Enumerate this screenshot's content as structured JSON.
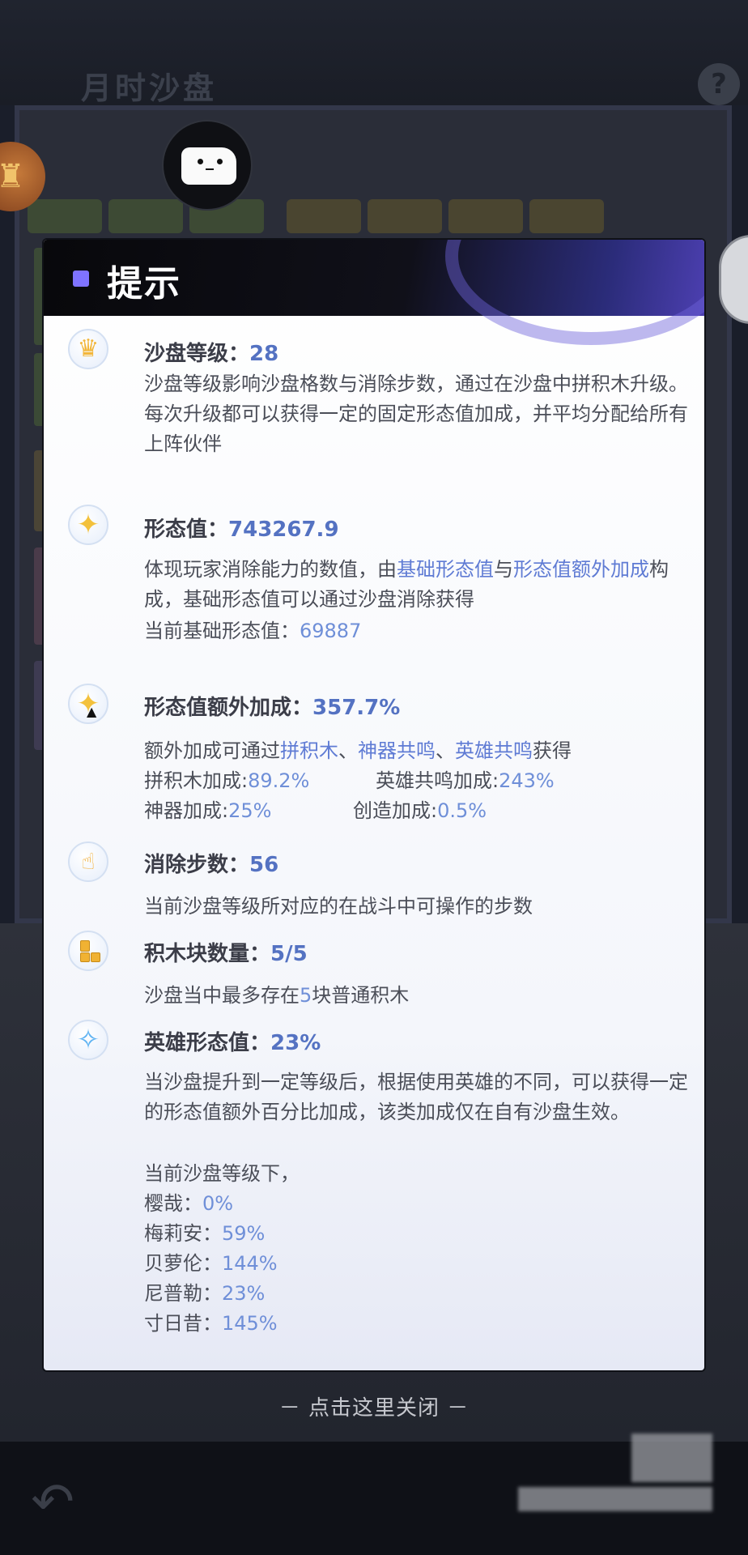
{
  "background": {
    "title": "月时沙盘",
    "help_glyph": "?"
  },
  "dialog": {
    "title": "提示",
    "sandbox_level": {
      "label": "沙盘等级：",
      "value": "28",
      "desc": "沙盘等级影响沙盘格数与消除步数，通过在沙盘中拼积木升级。每次升级都可以获得一定的固定形态值加成，并平均分配给所有上阵伙伴"
    },
    "form_value": {
      "label": "形态值：",
      "value": "743267.9",
      "desc_part1": "体现玩家消除能力的数值，由",
      "desc_link1": "基础形态值",
      "desc_part2": "与",
      "desc_link2": "形态值额外加成",
      "desc_part3": "构成，基础形态值可以通过沙盘消除获得",
      "base_label": "当前基础形态值：",
      "base_value": "69887"
    },
    "extra_bonus": {
      "label": "形态值额外加成：",
      "value": "357.7%",
      "desc_prefix": "额外加成可通过",
      "source1": "拼积木",
      "sep1": "、",
      "source2": "神器共鸣",
      "sep2": "、",
      "source3": "英雄共鸣",
      "desc_suffix": "获得",
      "block_label": "拼积木加成:",
      "block_value": "89.2%",
      "hero_label": "英雄共鸣加成:",
      "hero_value": "243%",
      "artifact_label": "神器加成:",
      "artifact_value": "25%",
      "create_label": "创造加成:",
      "create_value": "0.5%"
    },
    "steps": {
      "label": "消除步数：",
      "value": "56",
      "desc": "当前沙盘等级所对应的在战斗中可操作的步数"
    },
    "blocks": {
      "label": "积木块数量：",
      "value": "5/5",
      "desc_prefix": "沙盘当中最多存在",
      "desc_number": "5",
      "desc_suffix": "块普通积木"
    },
    "hero_form": {
      "label": "英雄形态值：",
      "value": "23%",
      "desc": "当沙盘提升到一定等级后，根据使用英雄的不同，可以获得一定的形态值额外百分比加成，该类加成仅在自有沙盘生效。",
      "current_label": "当前沙盘等级下，",
      "heroes": [
        {
          "name": "樱哉：",
          "value": "0%"
        },
        {
          "name": "梅莉安：",
          "value": "59%"
        },
        {
          "name": "贝萝伦：",
          "value": "144%"
        },
        {
          "name": "尼普勒：",
          "value": "23%"
        },
        {
          "name": "寸日昔：",
          "value": "145%"
        }
      ]
    },
    "icons": [
      "crown-icon",
      "star-icon",
      "star-up-icon",
      "foot-icon",
      "blocks-icon",
      "crystal-icon"
    ]
  },
  "close_hint": "－ 点击这里关闭 －"
}
